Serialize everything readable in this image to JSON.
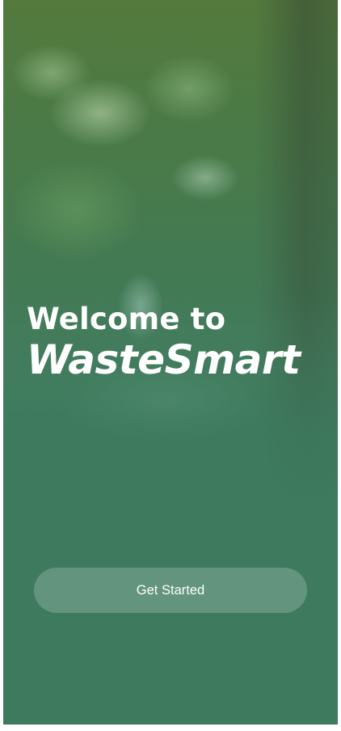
{
  "welcome": {
    "line1": "Welcome to",
    "brand": "WasteSmart"
  },
  "actions": {
    "get_started_label": "Get Started"
  },
  "colors": {
    "primary_green": "#3d7a5e",
    "button_fill": "rgba(255,255,255,0.20)",
    "text": "#ffffff"
  }
}
